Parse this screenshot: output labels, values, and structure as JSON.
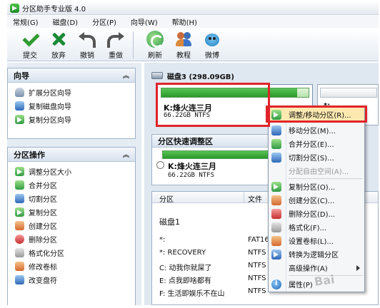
{
  "window": {
    "title": "分区助手专业版 4.0"
  },
  "menubar": [
    "常规(G)",
    "磁盘(D)",
    "分区(P)",
    "向导(W)",
    "帮助(H)"
  ],
  "toolbar": [
    {
      "label": "提交",
      "icon": "check-icon"
    },
    {
      "label": "放弃",
      "icon": "discard-x-icon"
    },
    {
      "label": "撤销",
      "icon": "undo-icon"
    },
    {
      "label": "重做",
      "icon": "redo-icon"
    },
    {
      "label": "刷新",
      "icon": "refresh-icon"
    },
    {
      "label": "教程",
      "icon": "tutorial-people-icon"
    },
    {
      "label": "微博",
      "icon": "weibo-icon"
    }
  ],
  "wizard_panel": {
    "title": "向导",
    "items": [
      "扩展分区向导",
      "复制磁盘向导",
      "复制分区向导"
    ]
  },
  "partition_ops_panel": {
    "title": "分区操作",
    "items": [
      "调整分区大小",
      "合并分区",
      "切割分区",
      "复制分区",
      "创建分区",
      "删除分区",
      "格式化分区",
      "修改卷标",
      "改变盘符"
    ]
  },
  "disk_view": {
    "disk_title": "磁盘3 (298.09GB)",
    "selected_partition": {
      "name": "K:烽火连三月",
      "size": "66.22GB NTFS",
      "used_fraction": 0.92
    },
    "next_partition_label": "*:"
  },
  "quick_adjust": {
    "title": "分区快速调整区",
    "partition_name": "K:烽火连三月",
    "partition_size": "66.22GB NTFS"
  },
  "partition_table": {
    "columns": [
      "分区",
      "文件"
    ],
    "disk_row": "磁盘1",
    "rows": [
      {
        "name": "*:",
        "fs": "FAT16"
      },
      {
        "name": "*: RECOVERY",
        "fs": "NTFS"
      },
      {
        "name": "C: 动我你就屎了",
        "fs": "NTFS"
      },
      {
        "name": "E: 点我即啥都有",
        "fs": "NTFS"
      },
      {
        "name": "F: 生活即娱乐不在山",
        "fs": "NTFS"
      }
    ]
  },
  "context_menu": [
    {
      "label": "调整/移动分区(R)...",
      "disabled": false,
      "highlight": true
    },
    {
      "label": "移动分区(M)...",
      "disabled": false
    },
    {
      "label": "合并分区(E)...",
      "disabled": false
    },
    {
      "label": "切割分区(S)...",
      "disabled": false
    },
    {
      "label": "分配自由空间(A)...",
      "disabled": true
    },
    {
      "label": "复制分区(O)...",
      "disabled": false
    },
    {
      "label": "创建分区(C)...",
      "disabled": false
    },
    {
      "label": "删除分区(D)...",
      "disabled": false
    },
    {
      "label": "格式化(F)...",
      "disabled": false
    },
    {
      "label": "设置卷标(L)...",
      "disabled": false
    },
    {
      "label": "转换为逻辑分区",
      "disabled": false
    },
    {
      "label": "高级操作(A)",
      "disabled": false,
      "submenu": true
    },
    {
      "label": "属性(P)",
      "disabled": false
    }
  ],
  "watermark": "Bai"
}
